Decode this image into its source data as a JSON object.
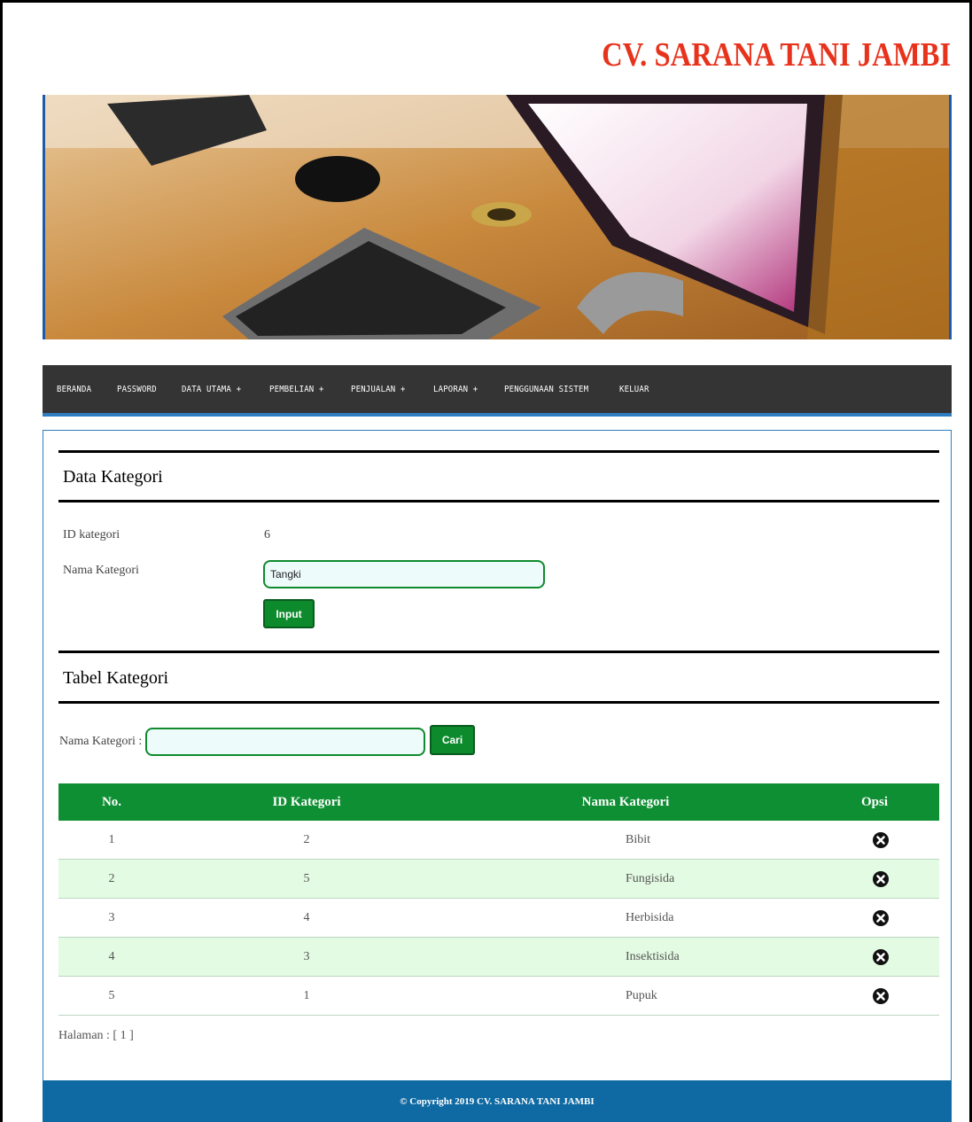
{
  "site": {
    "title": "CV. SARANA TANI JAMBI"
  },
  "nav": {
    "items": [
      "BERANDA",
      "PASSWORD",
      "DATA UTAMA +",
      "PEMBELIAN +",
      "PENJUALAN +",
      "LAPORAN +",
      "PENGGUNAAN SISTEM",
      "KELUAR"
    ]
  },
  "form": {
    "title": "Data Kategori",
    "id_label": "ID kategori",
    "id_value": "6",
    "name_label": "Nama Kategori",
    "name_value": "Tangki",
    "submit_label": "Input"
  },
  "table_section": {
    "title": "Tabel Kategori",
    "search_label": "Nama Kategori :",
    "search_value": "",
    "search_button": "Cari",
    "columns": [
      "No.",
      "ID Kategori",
      "Nama Kategori",
      "Opsi"
    ],
    "rows": [
      {
        "no": "1",
        "id": "2",
        "name": "Bibit"
      },
      {
        "no": "2",
        "id": "5",
        "name": "Fungisida"
      },
      {
        "no": "3",
        "id": "4",
        "name": "Herbisida"
      },
      {
        "no": "4",
        "id": "3",
        "name": "Insektisida"
      },
      {
        "no": "5",
        "id": "1",
        "name": "Pupuk"
      }
    ],
    "pager": "Halaman : [ 1 ]"
  },
  "footer": {
    "text": "© Copyright 2019 CV. SARANA TANI JAMBI"
  },
  "colors": {
    "title": "#e8331c",
    "nav_bg": "#343434",
    "accent_green": "#0f8f33",
    "footer_bg": "#0f6aa3"
  }
}
